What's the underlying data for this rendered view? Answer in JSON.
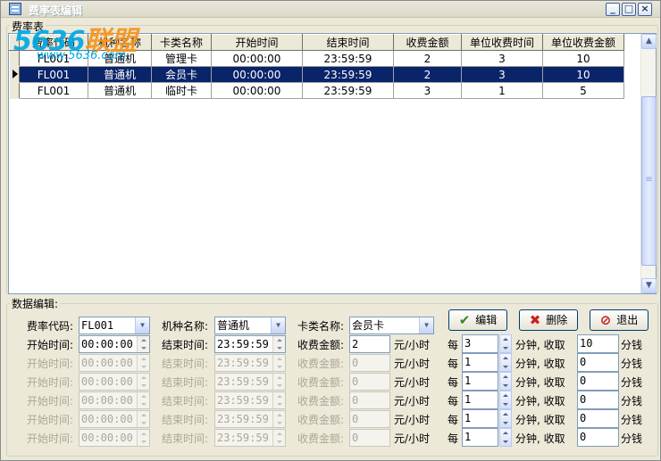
{
  "window": {
    "title": "费率表编辑"
  },
  "grid_section": {
    "label": "费率表"
  },
  "watermark": {
    "text_a": "5636",
    "text_b": "联盟",
    "url": "www.5636.com"
  },
  "grid": {
    "columns": [
      "费率代码",
      "机种名称",
      "卡类名称",
      "开始时间",
      "结束时间",
      "收费金额",
      "单位收费时间",
      "单位收费金额"
    ],
    "rows": [
      [
        "FL001",
        "普通机",
        "管理卡",
        "00:00:00",
        "23:59:59",
        "2",
        "3",
        "10"
      ],
      [
        "FL001",
        "普通机",
        "会员卡",
        "00:00:00",
        "23:59:59",
        "2",
        "3",
        "10"
      ],
      [
        "FL001",
        "普通机",
        "临时卡",
        "00:00:00",
        "23:59:59",
        "3",
        "1",
        "5"
      ]
    ],
    "selected_row": 1
  },
  "edit_section": {
    "label": "数据编辑:",
    "rate_code_label": "费率代码:",
    "rate_code": "FL001",
    "machine_label": "机种名称:",
    "machine": "普通机",
    "card_label": "卡类名称:",
    "card": "会员卡",
    "buttons": {
      "edit": "编辑",
      "delete": "删除",
      "exit": "退出"
    },
    "start_label": "开始时间:",
    "end_label": "结束时间:",
    "fee_label": "收费金额:",
    "unit_yuan": "元/小时",
    "every": "每",
    "minutes_charge": "分钟, 收取",
    "cents": "分钱",
    "rows": [
      {
        "start": "00:00:00",
        "end": "23:59:59",
        "fee": "2",
        "minutes": "3",
        "charge": "10",
        "enabled": true
      },
      {
        "start": "00:00:00",
        "end": "23:59:59",
        "fee": "0",
        "minutes": "1",
        "charge": "0",
        "enabled": false
      },
      {
        "start": "00:00:00",
        "end": "23:59:59",
        "fee": "0",
        "minutes": "1",
        "charge": "0",
        "enabled": false
      },
      {
        "start": "00:00:00",
        "end": "23:59:59",
        "fee": "0",
        "minutes": "1",
        "charge": "0",
        "enabled": false
      },
      {
        "start": "00:00:00",
        "end": "23:59:59",
        "fee": "0",
        "minutes": "1",
        "charge": "0",
        "enabled": false
      },
      {
        "start": "00:00:00",
        "end": "23:59:59",
        "fee": "0",
        "minutes": "1",
        "charge": "0",
        "enabled": false
      }
    ]
  }
}
